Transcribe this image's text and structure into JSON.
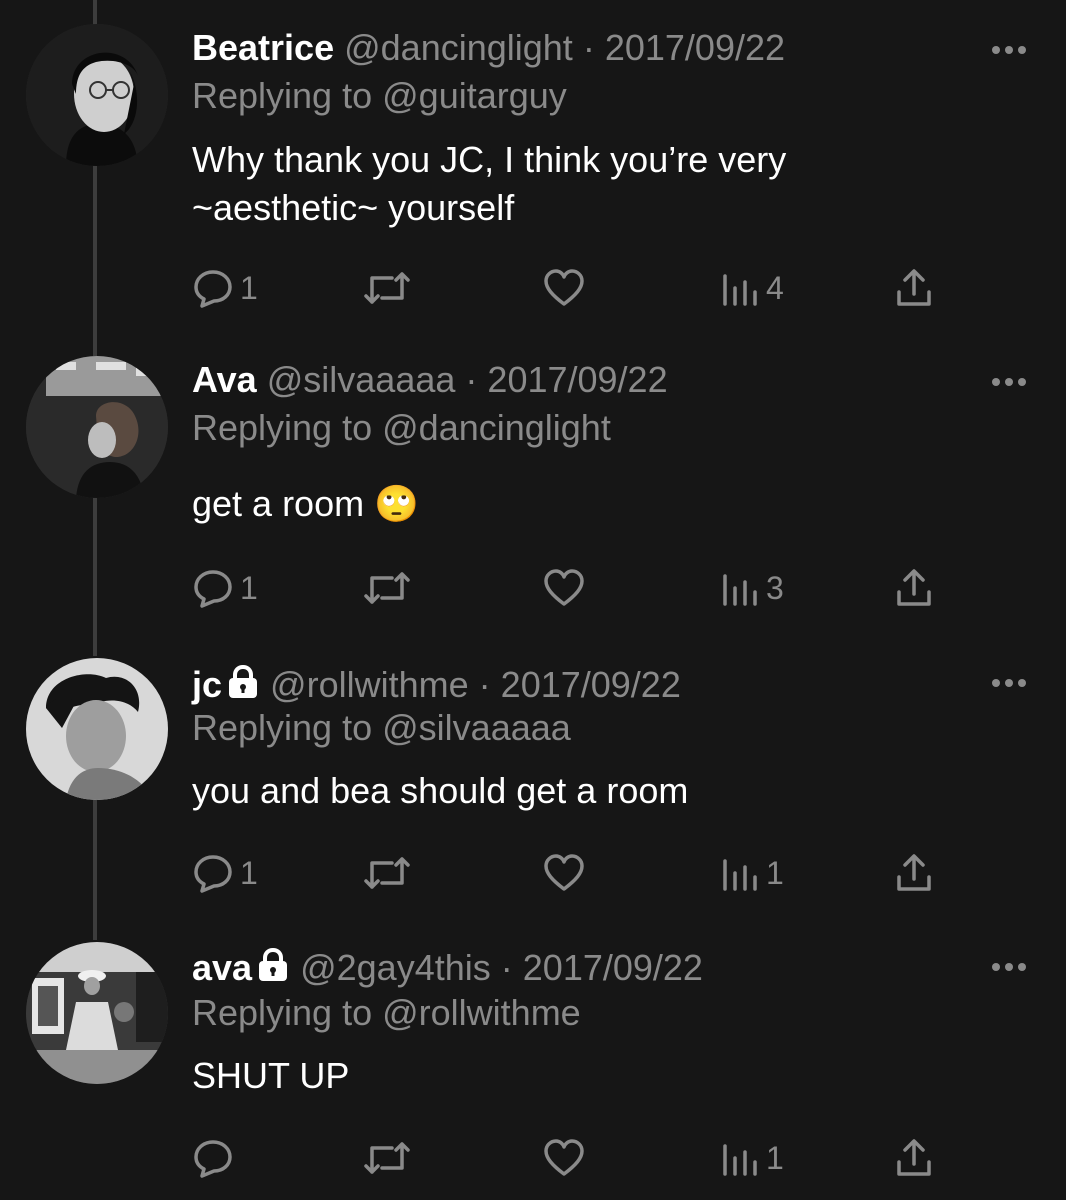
{
  "tweets": [
    {
      "name": "Beatrice",
      "handle": "@dancinglight",
      "sep": "·",
      "date": "2017/09/22",
      "protected": false,
      "replying_label": "Replying to",
      "replying_to": "@guitarguy",
      "text": "Why thank you JC, I think you’re very ~aesthetic~ yourself",
      "replies": "1",
      "views": "4"
    },
    {
      "name": "Ava",
      "handle": "@silvaaaaa",
      "sep": "·",
      "date": "2017/09/22",
      "protected": false,
      "replying_label": "Replying to",
      "replying_to": "@dancinglight",
      "text": "get a room 🙄",
      "replies": "1",
      "views": "3"
    },
    {
      "name": "jc",
      "handle": "@rollwithme",
      "sep": "·",
      "date": "2017/09/22",
      "protected": true,
      "replying_label": "Replying to",
      "replying_to": "@silvaaaaa",
      "text": "you and bea should get a room",
      "replies": "1",
      "views": "1"
    },
    {
      "name": "ava",
      "handle": "@2gay4this",
      "sep": "·",
      "date": "2017/09/22",
      "protected": true,
      "replying_label": "Replying to",
      "replying_to": "@rollwithme",
      "text": "SHUT UP",
      "replies": "",
      "views": "1"
    }
  ],
  "icons": {
    "reply": "reply-icon",
    "retweet": "retweet-icon",
    "like": "heart-icon",
    "views": "views-icon",
    "share": "share-icon",
    "more": "more-icon",
    "lock": "lock-icon"
  },
  "colors": {
    "background": "#161616",
    "text": "#ffffff",
    "muted": "#8a8a8a",
    "thread_line": "#3d3d3d"
  }
}
